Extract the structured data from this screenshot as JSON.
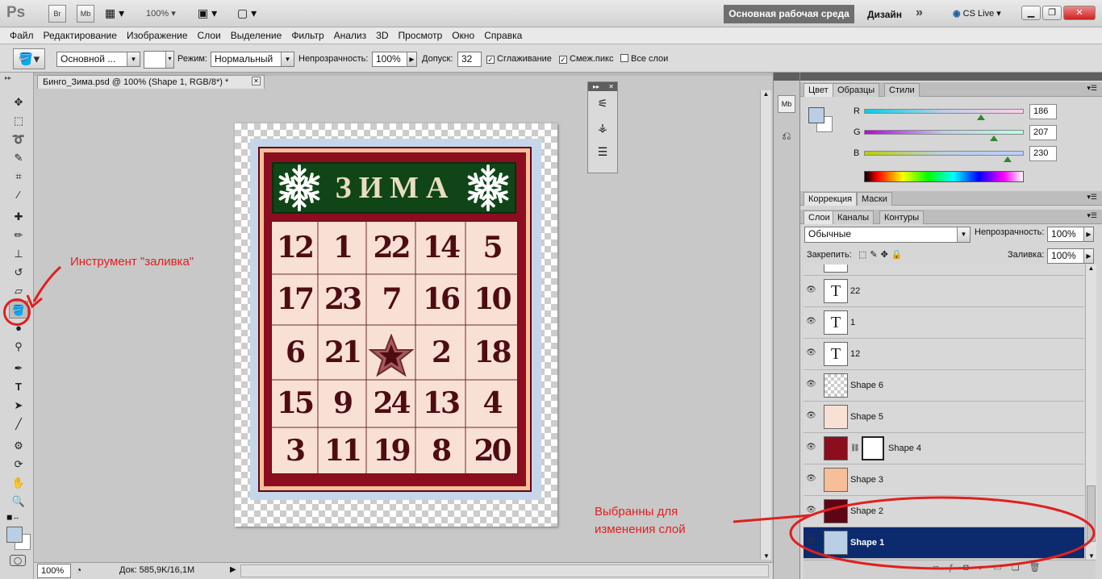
{
  "app": {
    "logo": "Ps",
    "bridge": "Br",
    "minibridge": "Mb",
    "zoom": "100%",
    "workspace_active": "Основная рабочая среда",
    "workspace_design": "Дизайн",
    "more": "»",
    "cs_live": "CS Live",
    "win_min": "▁",
    "win_max": "❐",
    "win_close": "✕"
  },
  "menu": [
    "Файл",
    "Редактирование",
    "Изображение",
    "Слои",
    "Выделение",
    "Фильтр",
    "Анализ",
    "3D",
    "Просмотр",
    "Окно",
    "Справка"
  ],
  "options": {
    "fill_source": "Основной ...",
    "mode_label": "Режим:",
    "mode_value": "Нормальный",
    "opacity_label": "Непрозрачность:",
    "opacity_value": "100%",
    "tolerance_label": "Допуск:",
    "tolerance_value": "32",
    "antialias_label": "Сглаживание",
    "contiguous_label": "Смеж.пикс",
    "all_layers_label": "Все слои",
    "check_mark": "✓"
  },
  "document": {
    "tab_title": "Бинго_Зима.psd @ 100% (Shape 1, RGB/8*) *",
    "close": "✕",
    "title": "ЗИМА",
    "numbers": [
      [
        "12",
        "1",
        "22",
        "14",
        "5"
      ],
      [
        "17",
        "23",
        "7",
        "16",
        "10"
      ],
      [
        "6",
        "21",
        "",
        "2",
        "18"
      ],
      [
        "15",
        "9",
        "24",
        "13",
        "4"
      ],
      [
        "3",
        "11",
        "19",
        "8",
        "20"
      ]
    ]
  },
  "status": {
    "zoom": "100%",
    "doc": "Док: 585,9K/16,1M"
  },
  "color_panel": {
    "tabs": [
      "Цвет",
      "Образцы",
      "Стили"
    ],
    "r_label": "R",
    "g_label": "G",
    "b_label": "B",
    "r": "186",
    "g": "207",
    "b": "230",
    "fg_color": "#bacfe6"
  },
  "adjust_panel": {
    "tabs": [
      "Коррекция",
      "Маски"
    ]
  },
  "layers_panel": {
    "tabs": [
      "Слои",
      "Каналы",
      "Контуры"
    ],
    "blend_mode": "Обычные",
    "opacity_label": "Непрозрачность:",
    "opacity_value": "100%",
    "lock_label": "Закрепить:",
    "fill_label": "Заливка:",
    "fill_value": "100%",
    "text_thumb": "T",
    "layers": [
      {
        "name": "22",
        "type": "text"
      },
      {
        "name": "1",
        "type": "text"
      },
      {
        "name": "12",
        "type": "text"
      },
      {
        "name": "Shape 6",
        "type": "transparent"
      },
      {
        "name": "Shape 5",
        "color": "#f9e0d4"
      },
      {
        "name": "Shape 4",
        "color": "#8c0e1e",
        "mask": true
      },
      {
        "name": "Shape 3",
        "color": "#f6be99"
      },
      {
        "name": "Shape 2",
        "color": "#5d0515"
      },
      {
        "name": "Shape 1",
        "color": "#bacfe6",
        "selected": true
      }
    ]
  },
  "annotations": {
    "tool_note": "Инструмент \"заливка\"",
    "layer_note_1": "Выбранны для",
    "layer_note_2": "изменения слой"
  }
}
